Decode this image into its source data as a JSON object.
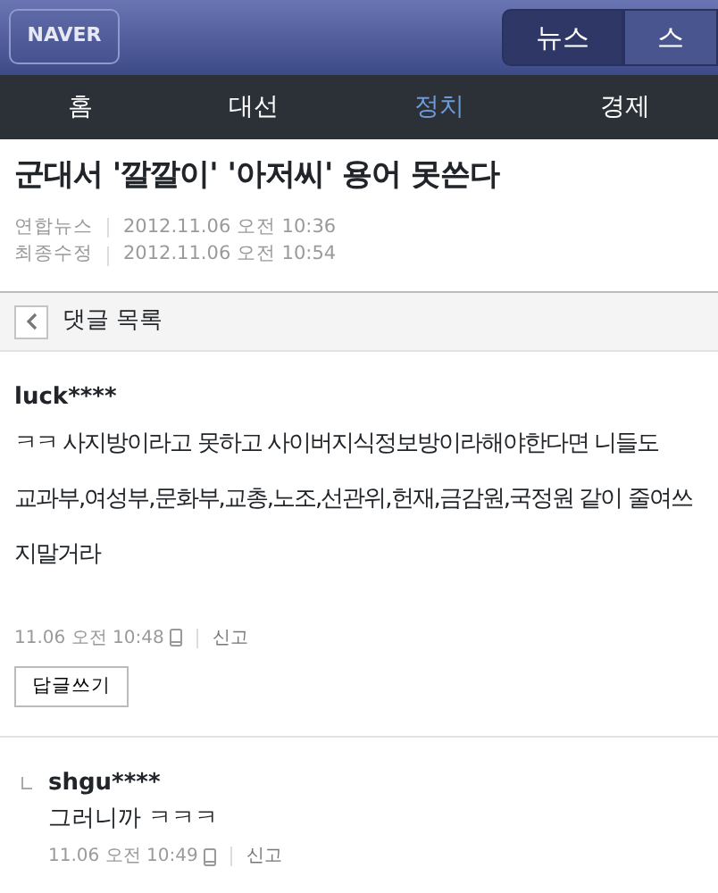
{
  "header": {
    "logo": "NAVER",
    "tabs": [
      {
        "label": "뉴스",
        "selected": true
      },
      {
        "label": "스",
        "selected": false
      }
    ]
  },
  "nav": [
    {
      "label": "홈",
      "selected": false
    },
    {
      "label": "대선",
      "selected": false
    },
    {
      "label": "정치",
      "selected": true
    },
    {
      "label": "경제",
      "selected": false
    }
  ],
  "article": {
    "title": "군대서 '깔깔이' '아저씨' 용어 못쓴다",
    "meta": [
      {
        "label": "연합뉴스",
        "value": "2012.11.06 오전 10:36"
      },
      {
        "label": "최종수정",
        "value": "2012.11.06 오전 10:54"
      }
    ]
  },
  "comments_bar": {
    "title": "댓글 목록"
  },
  "comments": [
    {
      "kind": "comment",
      "user": "luck****",
      "body": "ㅋㅋ 사지방이라고 못하고 사이버지식정보방이라해야한다면 니들도\n교과부,여성부,문화부,교총,노조,선관위,헌재,금감원,국정원 같이 줄여쓰\n지말거라",
      "time": "11.06 오전 10:48",
      "mobile": true,
      "report": "신고",
      "reply_button": "답글쓰기"
    },
    {
      "kind": "reply",
      "user": "shgu****",
      "body": "그러니까 ㅋㅋㅋ",
      "time": "11.06 오전 10:49",
      "mobile": true,
      "report": "신고"
    }
  ]
}
